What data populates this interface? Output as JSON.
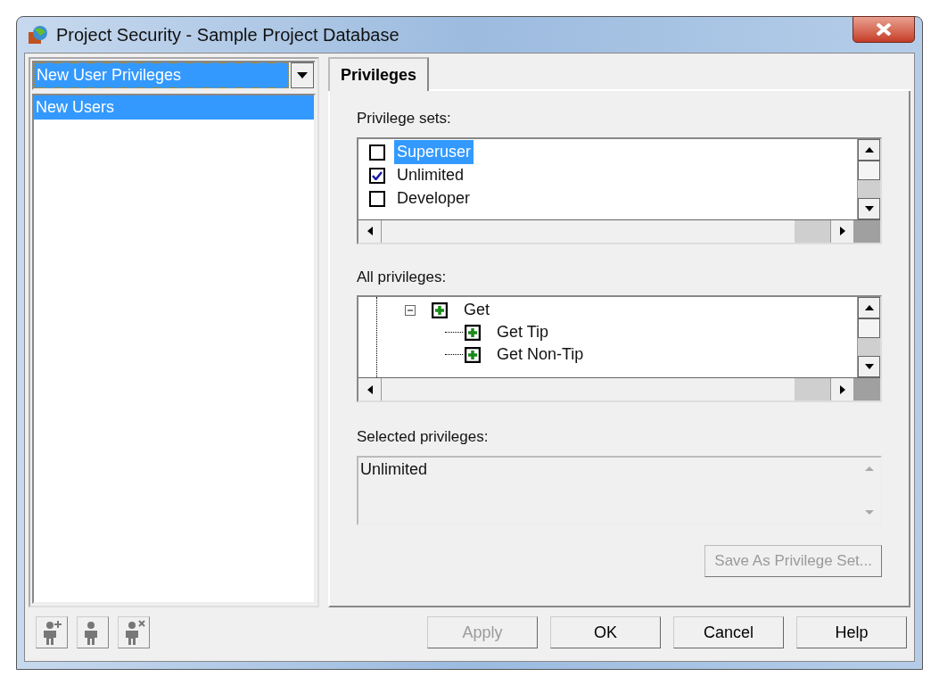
{
  "window": {
    "title": "Project Security - Sample Project Database"
  },
  "left_panel": {
    "dropdown": {
      "value": "New User Privileges"
    },
    "items": [
      {
        "label": "New Users",
        "selected": true
      }
    ]
  },
  "tabs": [
    {
      "label": "Privileges",
      "selected": true
    }
  ],
  "privilege_sets": {
    "label": "Privilege sets:",
    "items": [
      {
        "label": "Superuser",
        "checked": false,
        "selected": true
      },
      {
        "label": "Unlimited",
        "checked": true,
        "selected": false
      },
      {
        "label": "Developer",
        "checked": false,
        "selected": false
      }
    ]
  },
  "all_privileges": {
    "label": "All privileges:",
    "items": [
      {
        "label": "Get",
        "expanded": true,
        "children": [
          {
            "label": "Get Tip"
          },
          {
            "label": "Get Non-Tip"
          }
        ]
      }
    ]
  },
  "selected_privileges": {
    "label": "Selected privileges:",
    "value": "Unlimited"
  },
  "save_button": {
    "label": "Save As Privilege Set...",
    "disabled": true
  },
  "buttons": [
    {
      "label": "Apply",
      "disabled": true
    },
    {
      "label": "OK",
      "disabled": false
    },
    {
      "label": "Cancel",
      "disabled": false
    },
    {
      "label": "Help",
      "disabled": false
    }
  ]
}
